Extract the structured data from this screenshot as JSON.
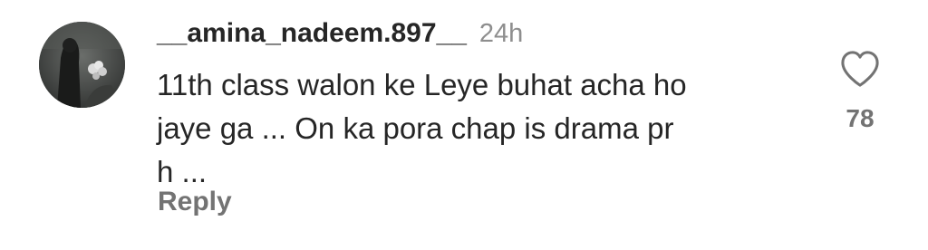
{
  "comment": {
    "username": "__amina_nadeem.897__",
    "timestamp": "24h",
    "text_lines": [
      "11th class walon ke Leye buhat acha ho",
      "jaye ga ... On ka pora chap is drama pr",
      "h ..."
    ],
    "reply_label": "Reply",
    "like_count": "78",
    "like_icon": "heart-outline-icon",
    "avatar_icon": "profile-avatar"
  }
}
